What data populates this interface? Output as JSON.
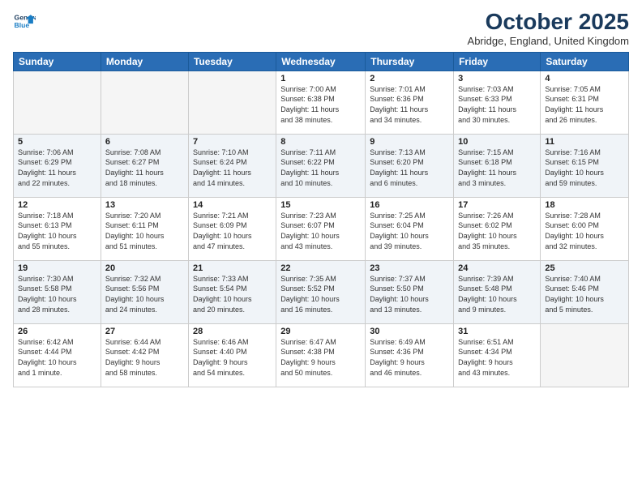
{
  "header": {
    "logo_line1": "General",
    "logo_line2": "Blue",
    "month": "October 2025",
    "location": "Abridge, England, United Kingdom"
  },
  "weekdays": [
    "Sunday",
    "Monday",
    "Tuesday",
    "Wednesday",
    "Thursday",
    "Friday",
    "Saturday"
  ],
  "weeks": [
    [
      {
        "day": "",
        "info": ""
      },
      {
        "day": "",
        "info": ""
      },
      {
        "day": "",
        "info": ""
      },
      {
        "day": "1",
        "info": "Sunrise: 7:00 AM\nSunset: 6:38 PM\nDaylight: 11 hours\nand 38 minutes."
      },
      {
        "day": "2",
        "info": "Sunrise: 7:01 AM\nSunset: 6:36 PM\nDaylight: 11 hours\nand 34 minutes."
      },
      {
        "day": "3",
        "info": "Sunrise: 7:03 AM\nSunset: 6:33 PM\nDaylight: 11 hours\nand 30 minutes."
      },
      {
        "day": "4",
        "info": "Sunrise: 7:05 AM\nSunset: 6:31 PM\nDaylight: 11 hours\nand 26 minutes."
      }
    ],
    [
      {
        "day": "5",
        "info": "Sunrise: 7:06 AM\nSunset: 6:29 PM\nDaylight: 11 hours\nand 22 minutes."
      },
      {
        "day": "6",
        "info": "Sunrise: 7:08 AM\nSunset: 6:27 PM\nDaylight: 11 hours\nand 18 minutes."
      },
      {
        "day": "7",
        "info": "Sunrise: 7:10 AM\nSunset: 6:24 PM\nDaylight: 11 hours\nand 14 minutes."
      },
      {
        "day": "8",
        "info": "Sunrise: 7:11 AM\nSunset: 6:22 PM\nDaylight: 11 hours\nand 10 minutes."
      },
      {
        "day": "9",
        "info": "Sunrise: 7:13 AM\nSunset: 6:20 PM\nDaylight: 11 hours\nand 6 minutes."
      },
      {
        "day": "10",
        "info": "Sunrise: 7:15 AM\nSunset: 6:18 PM\nDaylight: 11 hours\nand 3 minutes."
      },
      {
        "day": "11",
        "info": "Sunrise: 7:16 AM\nSunset: 6:15 PM\nDaylight: 10 hours\nand 59 minutes."
      }
    ],
    [
      {
        "day": "12",
        "info": "Sunrise: 7:18 AM\nSunset: 6:13 PM\nDaylight: 10 hours\nand 55 minutes."
      },
      {
        "day": "13",
        "info": "Sunrise: 7:20 AM\nSunset: 6:11 PM\nDaylight: 10 hours\nand 51 minutes."
      },
      {
        "day": "14",
        "info": "Sunrise: 7:21 AM\nSunset: 6:09 PM\nDaylight: 10 hours\nand 47 minutes."
      },
      {
        "day": "15",
        "info": "Sunrise: 7:23 AM\nSunset: 6:07 PM\nDaylight: 10 hours\nand 43 minutes."
      },
      {
        "day": "16",
        "info": "Sunrise: 7:25 AM\nSunset: 6:04 PM\nDaylight: 10 hours\nand 39 minutes."
      },
      {
        "day": "17",
        "info": "Sunrise: 7:26 AM\nSunset: 6:02 PM\nDaylight: 10 hours\nand 35 minutes."
      },
      {
        "day": "18",
        "info": "Sunrise: 7:28 AM\nSunset: 6:00 PM\nDaylight: 10 hours\nand 32 minutes."
      }
    ],
    [
      {
        "day": "19",
        "info": "Sunrise: 7:30 AM\nSunset: 5:58 PM\nDaylight: 10 hours\nand 28 minutes."
      },
      {
        "day": "20",
        "info": "Sunrise: 7:32 AM\nSunset: 5:56 PM\nDaylight: 10 hours\nand 24 minutes."
      },
      {
        "day": "21",
        "info": "Sunrise: 7:33 AM\nSunset: 5:54 PM\nDaylight: 10 hours\nand 20 minutes."
      },
      {
        "day": "22",
        "info": "Sunrise: 7:35 AM\nSunset: 5:52 PM\nDaylight: 10 hours\nand 16 minutes."
      },
      {
        "day": "23",
        "info": "Sunrise: 7:37 AM\nSunset: 5:50 PM\nDaylight: 10 hours\nand 13 minutes."
      },
      {
        "day": "24",
        "info": "Sunrise: 7:39 AM\nSunset: 5:48 PM\nDaylight: 10 hours\nand 9 minutes."
      },
      {
        "day": "25",
        "info": "Sunrise: 7:40 AM\nSunset: 5:46 PM\nDaylight: 10 hours\nand 5 minutes."
      }
    ],
    [
      {
        "day": "26",
        "info": "Sunrise: 6:42 AM\nSunset: 4:44 PM\nDaylight: 10 hours\nand 1 minute."
      },
      {
        "day": "27",
        "info": "Sunrise: 6:44 AM\nSunset: 4:42 PM\nDaylight: 9 hours\nand 58 minutes."
      },
      {
        "day": "28",
        "info": "Sunrise: 6:46 AM\nSunset: 4:40 PM\nDaylight: 9 hours\nand 54 minutes."
      },
      {
        "day": "29",
        "info": "Sunrise: 6:47 AM\nSunset: 4:38 PM\nDaylight: 9 hours\nand 50 minutes."
      },
      {
        "day": "30",
        "info": "Sunrise: 6:49 AM\nSunset: 4:36 PM\nDaylight: 9 hours\nand 46 minutes."
      },
      {
        "day": "31",
        "info": "Sunrise: 6:51 AM\nSunset: 4:34 PM\nDaylight: 9 hours\nand 43 minutes."
      },
      {
        "day": "",
        "info": ""
      }
    ]
  ]
}
